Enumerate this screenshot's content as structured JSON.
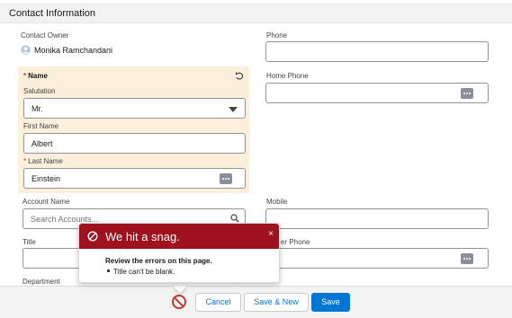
{
  "section": {
    "title": "Contact Information"
  },
  "contact_owner": {
    "label": "Contact Owner",
    "value": "Monika Ramchandani",
    "icon": "user-avatar-icon"
  },
  "name": {
    "label": "Name",
    "salutation": {
      "label": "Salutation",
      "value": "Mr."
    },
    "first_name": {
      "label": "First Name",
      "value": "Albert"
    },
    "last_name": {
      "label": "Last Name",
      "value": "Einstein"
    }
  },
  "account": {
    "label": "Account Name",
    "placeholder": "Search Accounts..."
  },
  "title_field": {
    "label": "Title",
    "value": ""
  },
  "department": {
    "label": "Department"
  },
  "phone": {
    "label": "Phone",
    "value": ""
  },
  "home_phone": {
    "label": "Home Phone",
    "value": ""
  },
  "mobile": {
    "label": "Mobile",
    "value": ""
  },
  "other_phone": {
    "label": "er Phone",
    "value": ""
  },
  "error_popover": {
    "title": "We hit a snag.",
    "close": "×",
    "review": "Review the errors on this page.",
    "errors": [
      "Title can't be blank."
    ]
  },
  "footer": {
    "cancel": "Cancel",
    "save_new": "Save & New",
    "save": "Save"
  },
  "colors": {
    "brand": "#0176d3",
    "error": "#a0111e",
    "panel": "#faf0dc"
  }
}
